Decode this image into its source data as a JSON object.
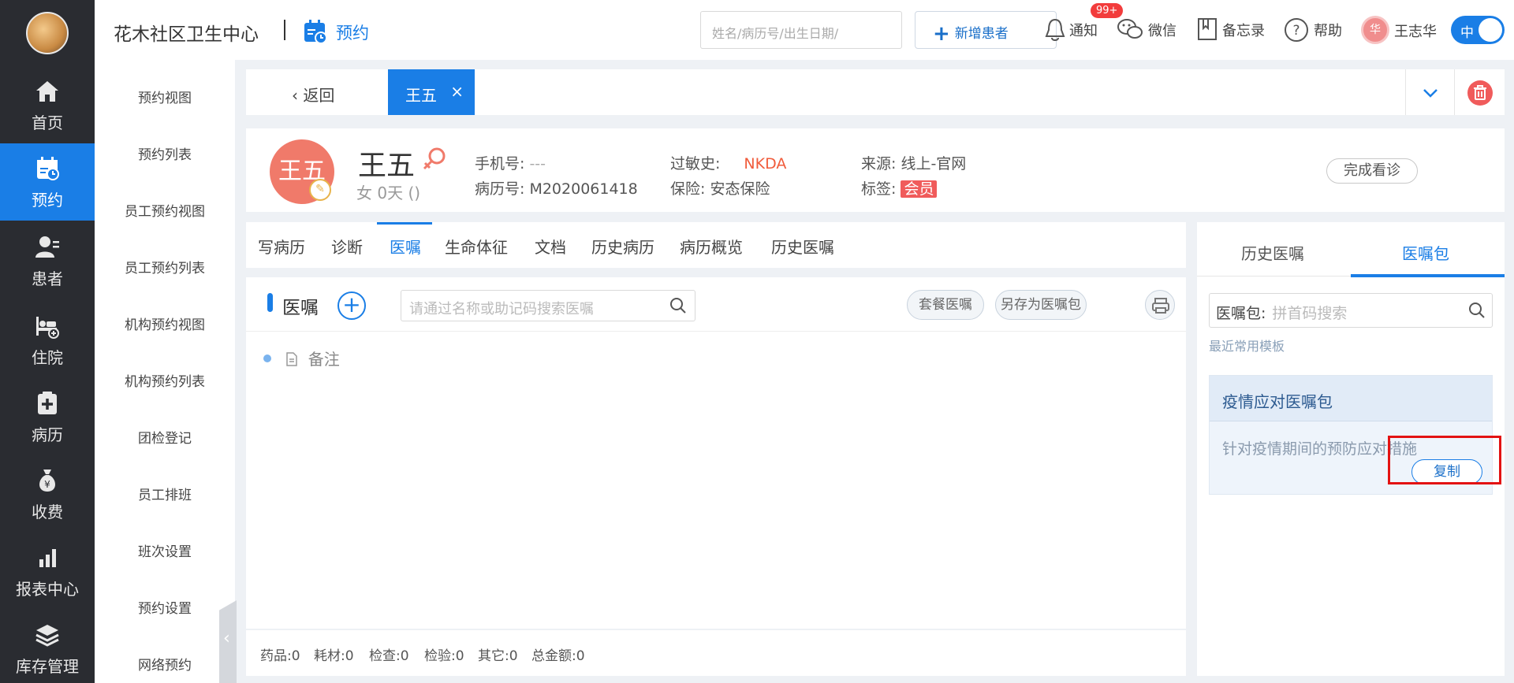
{
  "left_nav": {
    "items": [
      {
        "label": "首页",
        "icon": "home-icon"
      },
      {
        "label": "预约",
        "icon": "calendar-icon",
        "active": true
      },
      {
        "label": "患者",
        "icon": "patient-icon"
      },
      {
        "label": "住院",
        "icon": "bed-icon"
      },
      {
        "label": "病历",
        "icon": "medical-record-icon"
      },
      {
        "label": "收费",
        "icon": "money-bag-icon"
      },
      {
        "label": "报表中心",
        "icon": "bar-chart-icon"
      },
      {
        "label": "库存管理",
        "icon": "layers-icon"
      }
    ]
  },
  "sub_nav": {
    "items": [
      "预约视图",
      "预约列表",
      "员工预约视图",
      "员工预约列表",
      "机构预约视图",
      "机构预约列表",
      "团检登记",
      "员工排班",
      "班次设置",
      "预约设置",
      "网络预约"
    ]
  },
  "header": {
    "clinic_name": "花木社区卫生中心",
    "module": "预约",
    "search_placeholder": "姓名/病历号/出生日期/",
    "new_patient": "新增患者",
    "notify": "通知",
    "notify_badge": "99+",
    "wechat": "微信",
    "memo": "备忘录",
    "help": "帮助",
    "user_initial": "华",
    "user_name": "王志华",
    "lang_toggle": "中"
  },
  "tab_bar": {
    "back": "返回",
    "active_tab": "王五",
    "close": "×"
  },
  "patient": {
    "avatar_text": "王五",
    "name": "王五",
    "sub": "女  0天  ()",
    "phone_label": "手机号:",
    "phone_value": "---",
    "record_label": "病历号:",
    "record_value": "M2020061418",
    "allergy_label": "过敏史:",
    "allergy_value": "NKDA",
    "insurance_label": "保险:",
    "insurance_value": "安态保险",
    "source_label": "来源:",
    "source_value": "线上-官网",
    "tag_label": "标签:",
    "tag_value": "会员",
    "finish_button": "完成看诊"
  },
  "main_tabs": [
    "写病历",
    "诊断",
    "医嘱",
    "生命体征",
    "文档",
    "历史病历",
    "病历概览",
    "历史医嘱"
  ],
  "main_tabs_active": "医嘱",
  "orders": {
    "title": "医嘱",
    "search_placeholder": "请通过名称或助记码搜索医嘱",
    "package_orders": "套餐医嘱",
    "save_as_package": "另存为医嘱包",
    "note": "备注"
  },
  "footer": {
    "drugs": "药品:0",
    "materials": "耗材:0",
    "exams": "检查:0",
    "tests": "检验:0",
    "others": "其它:0",
    "total": "总金额:0"
  },
  "right_panel": {
    "tab_history": "历史医嘱",
    "tab_package": "医嘱包",
    "search_label": "医嘱包:",
    "search_placeholder": "拼首码搜索",
    "recent_label": "最近常用模板",
    "package_title": "疫情应对医嘱包",
    "package_desc": "针对疫情期间的预防应对措施",
    "copy_button": "复制"
  },
  "colors": {
    "primary": "#1a7ee6",
    "sidebar_bg": "#2a2c31",
    "danger": "#f05b5b",
    "highlight_box": "#e31212"
  }
}
